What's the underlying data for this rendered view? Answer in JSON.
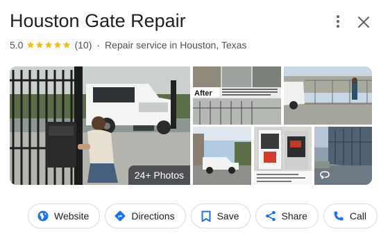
{
  "place": {
    "title": "Houston Gate Repair",
    "rating": "5.0",
    "star_count": 5,
    "review_count": "(10)",
    "separator": "·",
    "category": "Repair service in Houston, Texas"
  },
  "header_icons": {
    "more": "more-vert-icon",
    "close": "close-icon"
  },
  "gallery": {
    "photo_badge": "24+ Photos",
    "street_view_icon": "360-view-icon",
    "after_label": "After"
  },
  "actions": [
    {
      "label": "Website",
      "icon": "globe-icon"
    },
    {
      "label": "Directions",
      "icon": "directions-icon"
    },
    {
      "label": "Save",
      "icon": "bookmark-icon"
    },
    {
      "label": "Share",
      "icon": "share-icon"
    },
    {
      "label": "Call",
      "icon": "phone-icon"
    }
  ],
  "colors": {
    "star": "#fbbc04",
    "accent_blue": "#1a73e8",
    "text_primary": "#202124",
    "text_secondary": "#4d5156",
    "border": "#dadce0"
  }
}
